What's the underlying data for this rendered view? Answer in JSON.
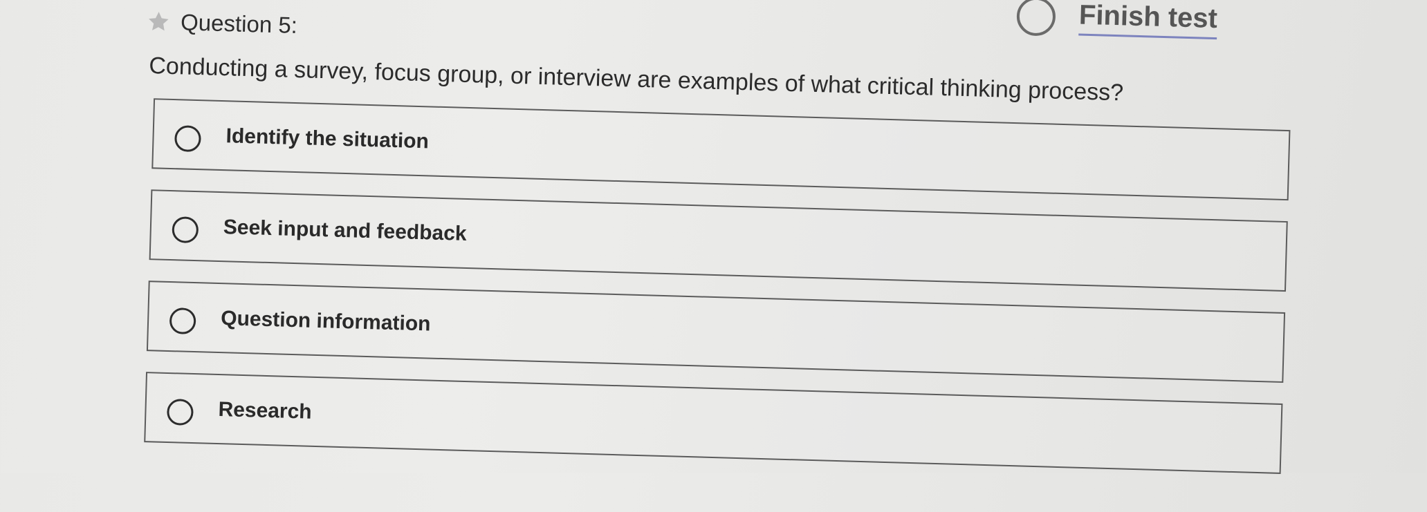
{
  "header": {
    "question_title": "Question 5:",
    "star_icon": "star-icon"
  },
  "toolbar": {
    "finish_label": "Finish test",
    "link_color": "#6b73b8"
  },
  "question": {
    "prompt": "Conducting a survey, focus group, or interview are examples of what critical thinking process?",
    "options": [
      {
        "label": "Identify the situation",
        "selected": false
      },
      {
        "label": "Seek input and feedback",
        "selected": false
      },
      {
        "label": "Question information",
        "selected": false
      },
      {
        "label": "Research",
        "selected": false
      }
    ]
  }
}
